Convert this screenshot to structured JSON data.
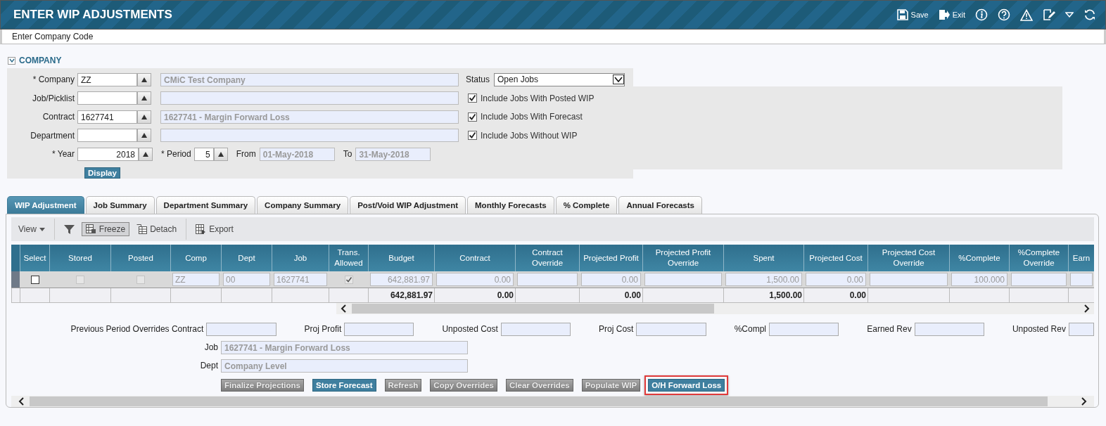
{
  "header": {
    "title": "ENTER WIP ADJUSTMENTS",
    "actions": [
      {
        "kind": "save",
        "label": "Save"
      },
      {
        "kind": "exit",
        "label": "Exit"
      },
      {
        "kind": "info"
      },
      {
        "kind": "help"
      },
      {
        "kind": "warning"
      },
      {
        "kind": "edit"
      },
      {
        "kind": "caret"
      },
      {
        "kind": "refresh"
      }
    ]
  },
  "message": "Enter Company Code",
  "section": {
    "title": "COMPANY",
    "expanded": true
  },
  "form": {
    "lookup_rows": [
      {
        "label": "* Company",
        "value": "ZZ",
        "description": "CMiC Test Company"
      },
      {
        "label": "Job/Picklist"
      },
      {
        "label": "Contract",
        "value": "1627741",
        "description": "1627741 - Margin Forward Loss"
      },
      {
        "label": "Department"
      }
    ],
    "status": {
      "label": "Status",
      "value": "Open Jobs"
    },
    "options": [
      {
        "label": "Include Jobs With Posted WIP",
        "checked": true
      },
      {
        "label": "Include Jobs With Forecast",
        "checked": true
      },
      {
        "label": "Include Jobs Without WIP",
        "checked": true
      }
    ],
    "year": {
      "label": "* Year",
      "value": "2018"
    },
    "period": {
      "label": "* Period",
      "value": "5"
    },
    "from": {
      "label": "From",
      "value": "01-May-2018"
    },
    "to": {
      "label": "To",
      "value": "31-May-2018"
    },
    "display_button": "Display"
  },
  "tabs": [
    {
      "label": "WIP Adjustment",
      "selected": true
    },
    {
      "label": "Job Summary",
      "selected": false
    },
    {
      "label": "Department Summary",
      "selected": false
    },
    {
      "label": "Company Summary",
      "selected": false
    },
    {
      "label": "Post/Void WIP Adjustment",
      "selected": false
    },
    {
      "label": "Monthly Forecasts",
      "selected": false
    },
    {
      "label": "% Complete",
      "selected": false
    },
    {
      "label": "Annual Forecasts",
      "selected": false
    }
  ],
  "toolbar": [
    {
      "kind": "view",
      "label": "View"
    },
    {
      "kind": "filter"
    },
    {
      "kind": "freeze",
      "label": "Freeze",
      "pressed": true
    },
    {
      "kind": "detach",
      "label": "Detach"
    },
    {
      "kind": "export",
      "label": "Export"
    }
  ],
  "grid": {
    "columns": [
      {
        "label": "Select"
      },
      {
        "label": "Stored"
      },
      {
        "label": "Posted"
      },
      {
        "label": "Comp"
      },
      {
        "label": "Dept"
      },
      {
        "label": "Job"
      },
      {
        "label": "Trans. Allowed"
      },
      {
        "label": "Budget",
        "total": "642,881.97"
      },
      {
        "label": "Contract",
        "total": "0.00"
      },
      {
        "label": "Contract Override"
      },
      {
        "label": "Projected Profit",
        "total": "0.00"
      },
      {
        "label": "Projected Profit Override"
      },
      {
        "label": "Spent",
        "total": "1,500.00"
      },
      {
        "label": "Projected Cost",
        "total": "0.00"
      },
      {
        "label": "Projected Cost Override"
      },
      {
        "label": "%Complete"
      },
      {
        "label": "%Complete Override"
      },
      {
        "label": "Earn"
      }
    ],
    "rows": [
      {
        "cells": [
          {
            "kind": "checkbox",
            "checked": false,
            "disabled": false
          },
          {
            "kind": "checkbox",
            "checked": false,
            "disabled": true
          },
          {
            "kind": "checkbox",
            "checked": false,
            "disabled": true
          },
          {
            "kind": "field",
            "value": "ZZ"
          },
          {
            "kind": "field",
            "value": "00"
          },
          {
            "kind": "field",
            "value": "1627741"
          },
          {
            "kind": "checkbox",
            "checked": true,
            "disabled": true
          },
          {
            "kind": "field",
            "value": "642,881.97"
          },
          {
            "kind": "field",
            "value": "0.00"
          },
          {
            "kind": "field"
          },
          {
            "kind": "field",
            "value": "0.00"
          },
          {
            "kind": "field"
          },
          {
            "kind": "field",
            "value": "1,500.00"
          },
          {
            "kind": "field",
            "value": "0.00"
          },
          {
            "kind": "field"
          },
          {
            "kind": "field",
            "value": "100.000"
          },
          {
            "kind": "field"
          },
          {
            "kind": "field"
          }
        ]
      }
    ]
  },
  "summary_fields": [
    {
      "label": "Previous Period Overrides Contract"
    },
    {
      "label": "Proj Profit"
    },
    {
      "label": "Unposted Cost"
    },
    {
      "label": "Proj Cost"
    },
    {
      "label": "%Compl"
    },
    {
      "label": "Earned Rev"
    },
    {
      "label": "Unposted Rev"
    }
  ],
  "job": {
    "label": "Job",
    "value": "1627741 - Margin Forward Loss"
  },
  "dept": {
    "label": "Dept",
    "value": "Company Level"
  },
  "actions": [
    {
      "label": "Finalize Projections",
      "disabled": true,
      "highlighted": false
    },
    {
      "label": "Store Forecast",
      "disabled": false,
      "highlighted": false
    },
    {
      "label": "Refresh",
      "disabled": true,
      "highlighted": false
    },
    {
      "label": "Copy Overrides",
      "disabled": true,
      "highlighted": false
    },
    {
      "label": "Clear Overrides",
      "disabled": true,
      "highlighted": false
    },
    {
      "label": "Populate WIP",
      "disabled": true,
      "highlighted": false
    },
    {
      "label": "O/H Forward Loss",
      "disabled": false,
      "highlighted": true
    }
  ]
}
